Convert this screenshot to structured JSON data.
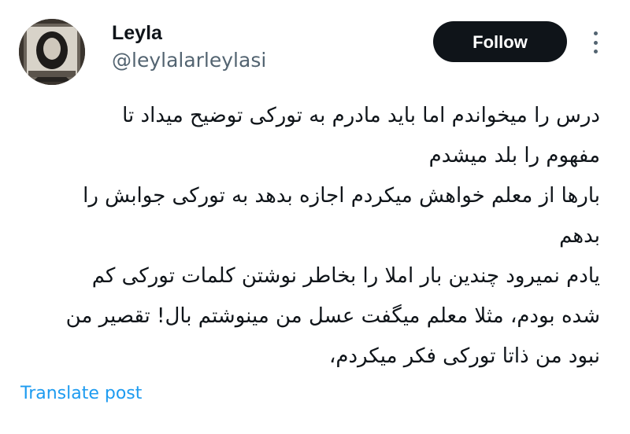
{
  "author": {
    "name": "Leyla",
    "handle": "@leylalarleylasi"
  },
  "actions": {
    "follow_label": "Follow",
    "more_icon": "more-horizontal-icon"
  },
  "post": {
    "lines": [
      "درس را میخواندم اما باید مادرم به تورکی توضیح میداد تا",
      "مفهوم را بلد میشدم",
      "بارها از معلم خواهش میکردم اجازه بدهد به تورکی جوابش را",
      "بدهم",
      "یادم نمیرود چندین بار املا را بخاطر نوشتن کلمات تورکی کم",
      "شده بودم، مثلا معلم میگفت عسل من مینوشتم بال! تقصیر من",
      "نبود من ذاتا تورکی فکر میکردم،"
    ]
  },
  "footer": {
    "translate_label": "Translate post"
  },
  "colors": {
    "accent": "#1d9bf0",
    "button_bg": "#0f1419",
    "secondary_text": "#536471"
  }
}
